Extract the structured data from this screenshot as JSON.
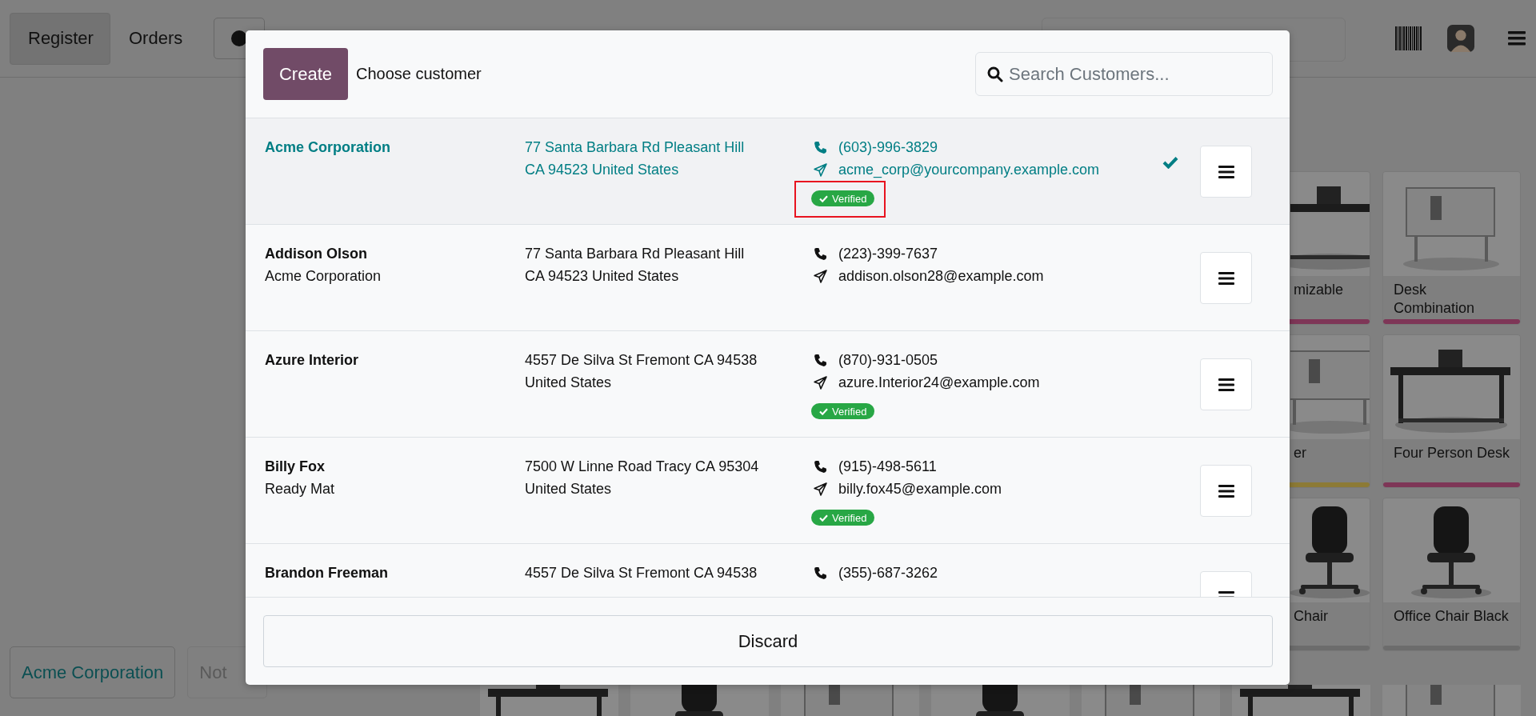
{
  "header": {
    "tabs": [
      {
        "label": "Register",
        "selected": true
      },
      {
        "label": "Orders",
        "selected": false
      }
    ]
  },
  "order_panel": {
    "customer_button": "Acme Corporation",
    "note_button": "Not"
  },
  "products": [
    {
      "name": "mizable",
      "color": "#7e3657"
    },
    {
      "name": "Desk Combination",
      "color": "#7e3657"
    },
    {
      "name": "er",
      "color": "#8c7a36"
    },
    {
      "name": "Four Person Desk",
      "color": "#7e3657"
    },
    {
      "name": "Chair",
      "color": "#6c6c6c"
    },
    {
      "name": "Office Chair Black",
      "color": "#6c6c6c"
    }
  ],
  "modal": {
    "create_button": "Create",
    "title": "Choose customer",
    "search": {
      "placeholder": "Search Customers..."
    },
    "customers": [
      {
        "name": "Acme Corporation",
        "address": "77 Santa Barbara Rd Pleasant Hill\nCA 94523 United States",
        "phone": "(603)-996-3829",
        "email": "acme_corp@yourcompany.example.com",
        "verified": true,
        "verified_label": "Verified",
        "highlighted": true,
        "selected": true
      },
      {
        "name": "Addison Olson",
        "company": "Acme Corporation",
        "address": "77 Santa Barbara Rd Pleasant Hill\nCA 94523 United States",
        "phone": "(223)-399-7637",
        "email": "addison.olson28@example.com",
        "verified": false,
        "highlighted": false,
        "selected": false
      },
      {
        "name": "Azure Interior",
        "address": "4557 De Silva St Fremont CA 94538\nUnited States",
        "phone": "(870)-931-0505",
        "email": "azure.Interior24@example.com",
        "verified": true,
        "verified_label": "Verified",
        "highlighted": false,
        "selected": false
      },
      {
        "name": "Billy Fox",
        "company": "Ready Mat",
        "address": "7500 W Linne Road Tracy CA 95304\nUnited States",
        "phone": "(915)-498-5611",
        "email": "billy.fox45@example.com",
        "verified": true,
        "verified_label": "Verified",
        "highlighted": false,
        "selected": false
      },
      {
        "name": "Brandon Freeman",
        "address": "4557 De Silva St Fremont CA 94538",
        "phone": "(355)-687-3262",
        "verified": false,
        "highlighted": false,
        "selected": false
      }
    ],
    "discard_button": "Discard"
  }
}
